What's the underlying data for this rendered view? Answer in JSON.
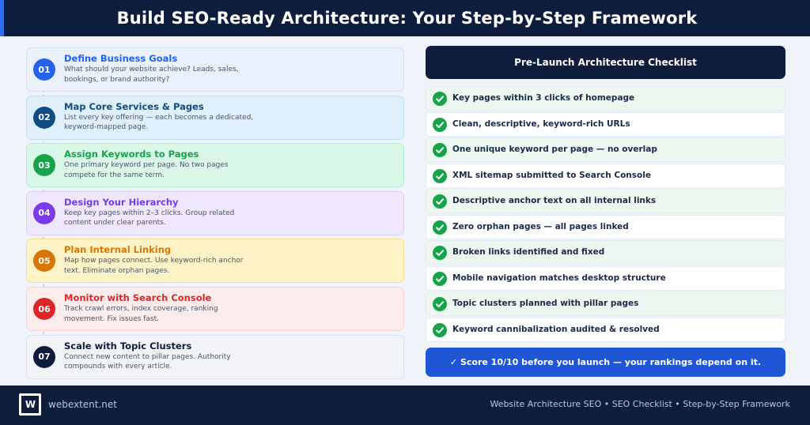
{
  "header": {
    "title": "Build SEO-Ready Architecture: Your Step-by-Step Framework"
  },
  "steps": [
    {
      "num": "01",
      "title": "Define Business Goals",
      "desc": "What should your website achieve? Leads, sales, bookings, or brand authority?",
      "accent": "#2563eb",
      "bg": "#eaf1fc",
      "border": "#d3e2f6"
    },
    {
      "num": "02",
      "title": "Map Core Services & Pages",
      "desc": "List every key offering — each becomes a dedicated, keyword-mapped page.",
      "accent": "#0f4c81",
      "bg": "#dff0fc",
      "border": "#bddff7"
    },
    {
      "num": "03",
      "title": "Assign Keywords to Pages",
      "desc": "One primary keyword per page. No two pages compete for the same term.",
      "accent": "#16a34a",
      "bg": "#d9f8e8",
      "border": "#b2ecce"
    },
    {
      "num": "04",
      "title": "Design Your Hierarchy",
      "desc": "Keep key pages within 2–3 clicks. Group related content under clear parents.",
      "accent": "#7c3aed",
      "bg": "#efe7fd",
      "border": "#dccdfa"
    },
    {
      "num": "05",
      "title": "Plan Internal Linking",
      "desc": "Map how pages connect. Use keyword-rich anchor text. Eliminate orphan pages.",
      "accent": "#d97706",
      "bg": "#fdf3c6",
      "border": "#f5df8f"
    },
    {
      "num": "06",
      "title": "Monitor with Search Console",
      "desc": "Track crawl errors, index coverage, ranking movement. Fix issues fast.",
      "accent": "#dc2626",
      "bg": "#fdecec",
      "border": "#f7d2d2"
    },
    {
      "num": "07",
      "title": "Scale with Topic Clusters",
      "desc": "Connect new content to pillar pages. Authority compounds with every article.",
      "accent": "#0f1d3d",
      "bg": "#f2f4f8",
      "border": "#dde2ea"
    }
  ],
  "checklist": {
    "title": "Pre-Launch Architecture Checklist",
    "items": [
      "Key pages within 3 clicks of homepage",
      "Clean, descriptive, keyword-rich URLs",
      "One unique keyword per page — no overlap",
      "XML sitemap submitted to Search Console",
      "Descriptive anchor text on all internal links",
      "Zero orphan pages — all pages linked",
      "Broken links identified and fixed",
      "Mobile navigation matches desktop structure",
      "Topic clusters planned with pillar pages",
      "Keyword cannibalization audited & resolved"
    ],
    "score": "✓  Score 10/10 before you launch — your rankings depend on it."
  },
  "footer": {
    "logo": "W",
    "site": "webextent.net",
    "tags": "Website Architecture SEO  •  SEO Checklist  •  Step-by-Step Framework"
  }
}
